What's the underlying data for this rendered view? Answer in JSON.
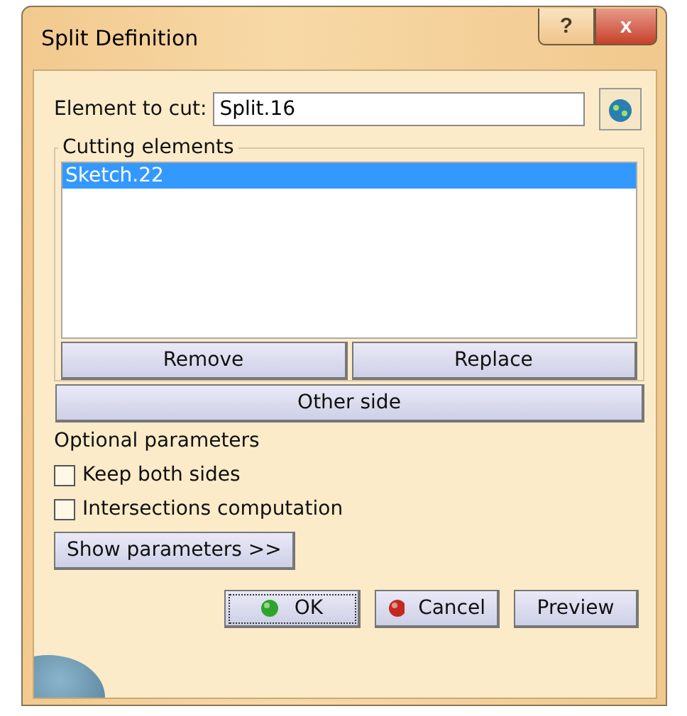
{
  "window": {
    "title": "Split Definition",
    "help_button": "?",
    "close_button": "x"
  },
  "element_to_cut": {
    "label": "Element to cut:",
    "value": "Split.16"
  },
  "cutting_elements": {
    "title": "Cutting elements",
    "items": [
      {
        "label": "Sketch.22",
        "selected": true
      }
    ],
    "buttons": [
      "Remove",
      "Replace"
    ]
  },
  "other_side_button": "Other side",
  "optional_parameters": {
    "title": "Optional parameters",
    "options": [
      {
        "label": "Keep both sides",
        "checked": false
      },
      {
        "label": "Intersections computation",
        "checked": false
      }
    ]
  },
  "show_parameters_button": "Show parameters >>",
  "footer_buttons": [
    {
      "kind": "ok",
      "label": "OK"
    },
    {
      "kind": "cancel",
      "label": "Cancel"
    },
    {
      "kind": "preview",
      "label": "Preview"
    }
  ]
}
